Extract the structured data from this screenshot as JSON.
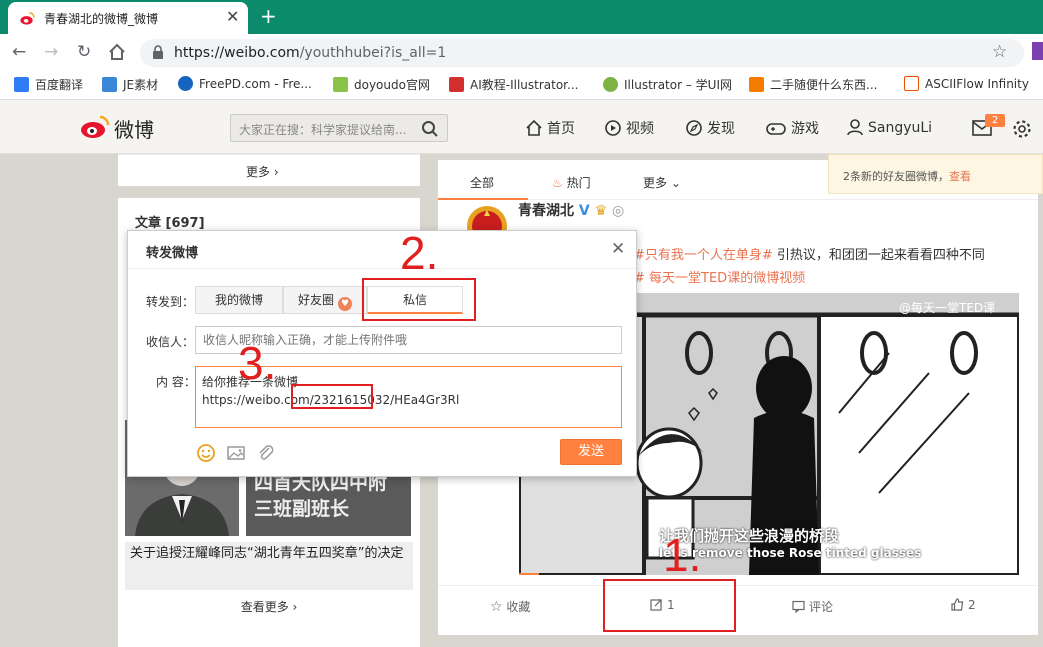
{
  "browser": {
    "tab_title": "青春湖北的微博_微博",
    "tab_close": "✕",
    "new_tab": "+",
    "url_host": "https://weibo.com",
    "url_rest": "/youthhubei?is_all=1",
    "bookmarks": [
      {
        "label": "百度翻译",
        "color": "#2f7cf6"
      },
      {
        "label": "JE素材",
        "color": "#3a87d8"
      },
      {
        "label": "FreePD.com - Fre...",
        "color": "#1565c0"
      },
      {
        "label": "doyoudo官网",
        "color": "#8bc34a"
      },
      {
        "label": "AI教程-Illustrator...",
        "color": "#d32f2f"
      },
      {
        "label": "Illustrator – 学UI网",
        "color": "#7cb342"
      },
      {
        "label": "二手随便什么东西...",
        "color": "#f57c00"
      },
      {
        "label": "ASCIIFlow Infinity",
        "color": "#e65100"
      }
    ]
  },
  "weibo_header": {
    "logo_text": "微博",
    "search_placeholder": "大家正在搜：科学家提议给南...",
    "nav": {
      "home": "首页",
      "video": "视频",
      "discover": "发现",
      "game": "游戏",
      "user": "SangyuLi"
    },
    "message_badge": "2",
    "accent": "#ff8140"
  },
  "left_column": {
    "more_label": "更多 ›",
    "card_title": "文章 [697]",
    "image_text_line1": "四首天队四中附",
    "image_text_line2": "三班副班长",
    "article_caption": "关于追授汪耀峰同志“湖北青年五四奖章”的决定",
    "see_more": "查看更多 ›"
  },
  "feed": {
    "tabs": {
      "all": "全部",
      "hot": "热门",
      "more": "更多"
    },
    "author": "青春湖北",
    "post_text_hashtag": "#只有我一个人在单身#",
    "post_text_rest": " 引热议，和团团一起来看看四种不同",
    "post_source": "# 每天一堂TED课的微博视频",
    "video_watermark": "@每天一堂TED课",
    "video_sub_cn": "让我们抛开这些浪漫的桥段",
    "video_sub_en": "let's remove those Rose tinted glasses",
    "actions": {
      "favorite": "收藏",
      "repost": "1",
      "comment": "评论",
      "like": "2"
    }
  },
  "notification": {
    "text": "2条新的好友圈微博，",
    "link": "查看"
  },
  "modal": {
    "title": "转发微博",
    "close": "✕",
    "forward_to_label": "转发到：",
    "seg_my_weibo": "我的微博",
    "seg_friends": "好友圈",
    "seg_private": "私信",
    "recipient_label": "收信人：",
    "recipient_placeholder": "收信人昵称输入正确，才能上传附件哦",
    "content_label": "内  容：",
    "content_line1": "给你推荐一条微博",
    "content_line2": "https://weibo.com/2321615032/HEa4Gr3Rl",
    "send_label": "发送"
  },
  "annotations": {
    "num_1": "1.",
    "num_2": "2.",
    "num_3": "3.",
    "color": "#e02020"
  }
}
